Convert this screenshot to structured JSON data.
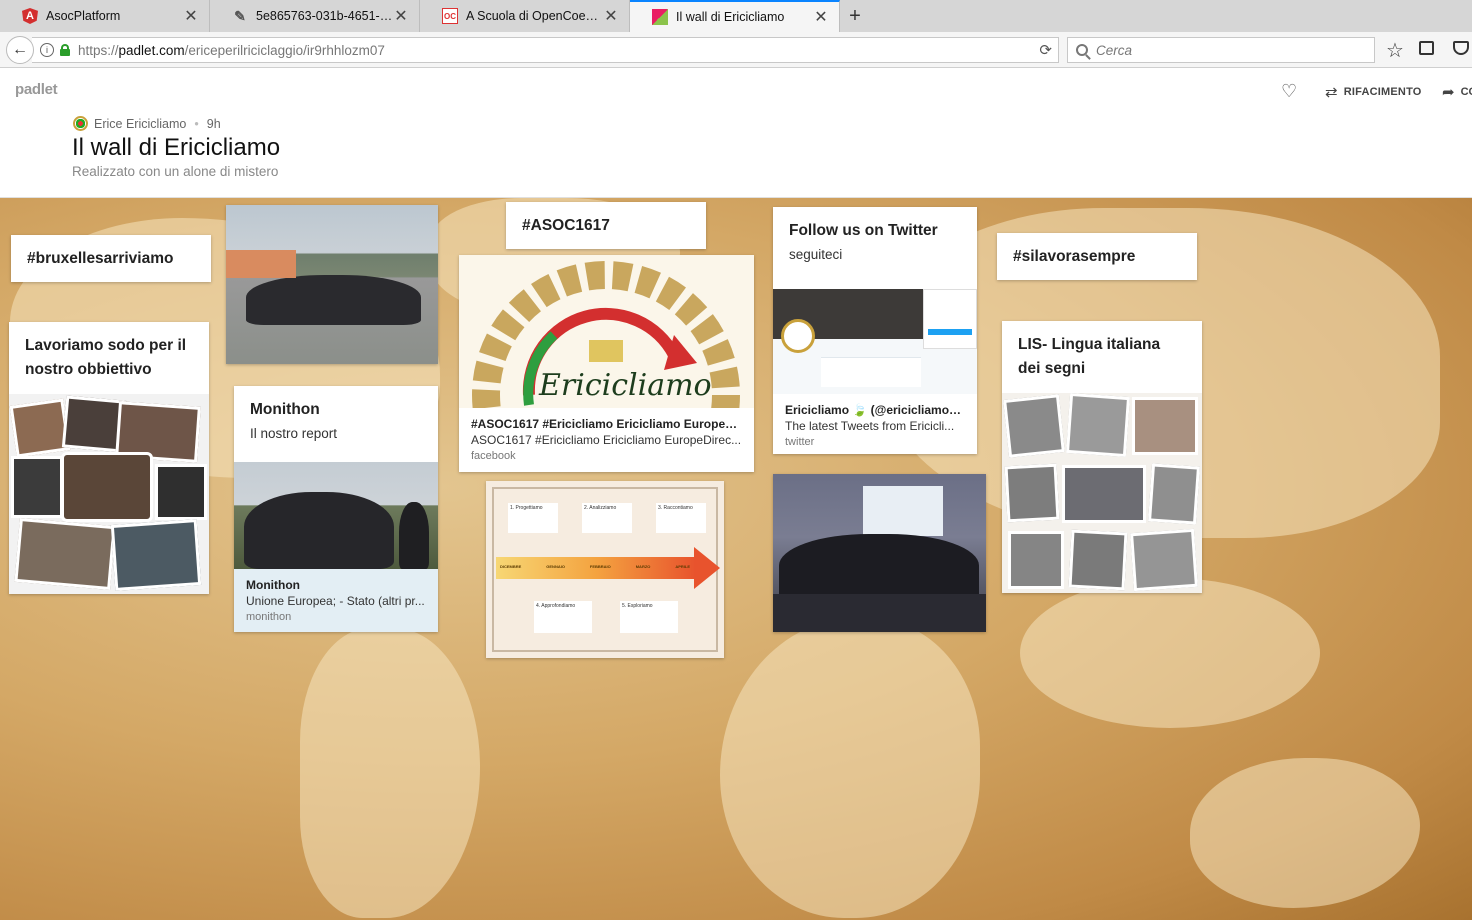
{
  "browser": {
    "tabs": [
      {
        "title": "AsocPlatform",
        "favicon": "angular-icon",
        "active": false
      },
      {
        "title": "5e865763-031b-4651-b2ee...",
        "favicon": "pen-icon",
        "active": false
      },
      {
        "title": "A Scuola di OpenCoesione",
        "favicon": "opencoesione-icon",
        "active": false
      },
      {
        "title": "Il wall di Ericicliamo",
        "favicon": "padlet-icon",
        "active": true
      }
    ],
    "url": {
      "protocol": "https://",
      "host": "padlet.com",
      "path": "/ericeperilriciclaggio/ir9rhhlozm07"
    },
    "search_placeholder": "Cerca"
  },
  "padlet": {
    "logo": "padlet",
    "author": "Erice Ericicliamo",
    "time": "9h",
    "title": "Il wall di Ericicliamo",
    "subtitle": "Realizzato con un alone di mistero",
    "remake_label": "RIFACIMENTO",
    "share_label": "CO"
  },
  "cards": {
    "bruxelles": {
      "subject": "#bruxellesarriviamo"
    },
    "lavoriamo": {
      "subject": "Lavoriamo sodo per il nostro obbiettivo"
    },
    "monithon": {
      "subject": "Monithon",
      "body": "Il nostro report",
      "link_title": "Monithon",
      "link_desc": "Unione Europea; - Stato (altri pr...",
      "link_source": "monithon"
    },
    "asoc": {
      "subject": "#ASOC1617",
      "logo_text": "Ericicliamo",
      "link_title": "#ASOC1617 #Ericicliamo Ericicliamo EuropeDir...",
      "link_desc": "ASOC1617 #Ericicliamo Ericicliamo EuropeDirec...",
      "link_source": "facebook"
    },
    "timeline": {
      "steps_top": [
        "1. Progettiamo",
        "2. Analizziamo",
        "3. Raccontiamo"
      ],
      "steps_bottom": [
        "4. Approfondiamo",
        "5. Esploriamo"
      ],
      "months": [
        "DICEMBRE",
        "GENNAIO",
        "FEBBRAIO",
        "MARZO",
        "APRILE"
      ]
    },
    "twitter": {
      "subject": "Follow us on Twitter",
      "body": "seguiteci",
      "link_title": "Ericicliamo 🍃 (@ericicliamo) | ...",
      "link_desc": "The latest Tweets from Ericicli...",
      "link_source": "twitter"
    },
    "silavora": {
      "subject": "#silavorasempre"
    },
    "lis": {
      "subject": "LIS- Lingua italiana dei segni"
    }
  }
}
